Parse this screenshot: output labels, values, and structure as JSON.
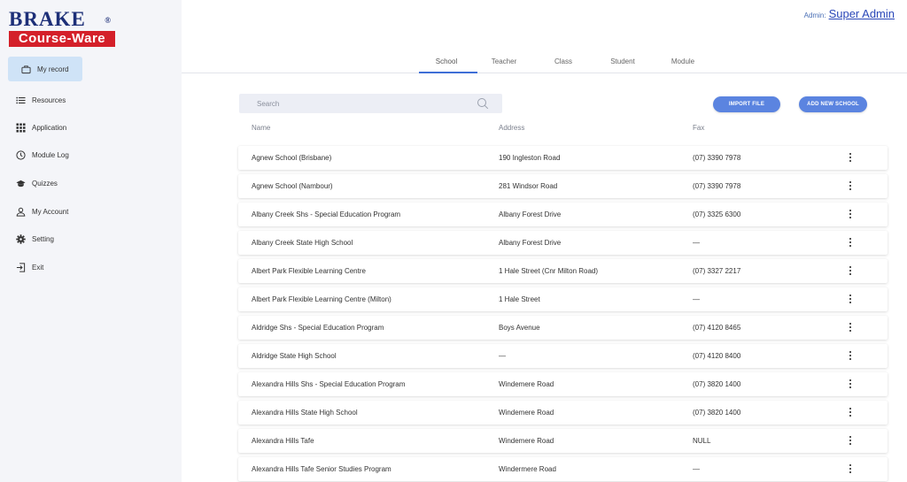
{
  "logo": {
    "brand_top": "BRAKE",
    "brand_bottom": "Course-Ware",
    "registered": "®"
  },
  "sidebar": {
    "active_item": {
      "label": "My record",
      "icon": "briefcase-icon"
    },
    "items": [
      {
        "label": "Resources",
        "icon": "list-icon"
      },
      {
        "label": "Application",
        "icon": "grid-icon"
      },
      {
        "label": "Module Log",
        "icon": "clock-icon"
      },
      {
        "label": "Quizzes",
        "icon": "graduation-cap-icon"
      },
      {
        "label": "My Account",
        "icon": "user-icon"
      },
      {
        "label": "Setting",
        "icon": "gear-icon"
      },
      {
        "label": "Exit",
        "icon": "exit-icon"
      }
    ]
  },
  "header": {
    "admin_label": "Admin:",
    "admin_name": "Super Admin"
  },
  "tabs": [
    {
      "label": "School",
      "active": true
    },
    {
      "label": "Teacher",
      "active": false
    },
    {
      "label": "Class",
      "active": false
    },
    {
      "label": "Student",
      "active": false
    },
    {
      "label": "Module",
      "active": false
    }
  ],
  "toolbar": {
    "search_placeholder": "Search",
    "search_value": "",
    "import_label": "IMPORT FILE",
    "add_label": "ADD NEW SCHOOL"
  },
  "table": {
    "columns": [
      "Name",
      "Address",
      "Fax"
    ],
    "rows": [
      {
        "name": "Agnew School (Brisbane)",
        "address": "190 Ingleston Road",
        "fax": "(07) 3390 7978"
      },
      {
        "name": "Agnew School (Nambour)",
        "address": "281 Windsor Road",
        "fax": "(07) 3390 7978"
      },
      {
        "name": "Albany Creek Shs - Special Education Program",
        "address": "Albany Forest Drive",
        "fax": "(07) 3325 6300"
      },
      {
        "name": "Albany Creek State High School",
        "address": "Albany Forest Drive",
        "fax": "—"
      },
      {
        "name": "Albert Park Flexible Learning Centre",
        "address": "1 Hale Street (Cnr Milton Road)",
        "fax": "(07) 3327 2217"
      },
      {
        "name": "Albert Park Flexible Learning Centre (Milton)",
        "address": "1 Hale Street",
        "fax": "—"
      },
      {
        "name": "Aldridge Shs - Special Education Program",
        "address": "Boys Avenue",
        "fax": "(07) 4120 8465"
      },
      {
        "name": "Aldridge State High School",
        "address": "—",
        "fax": "(07) 4120 8400"
      },
      {
        "name": "Alexandra Hills Shs - Special Education Program",
        "address": "Windemere Road",
        "fax": "(07) 3820 1400"
      },
      {
        "name": "Alexandra Hills State High School",
        "address": "Windemere Road",
        "fax": "(07) 3820 1400"
      },
      {
        "name": "Alexandra Hills Tafe",
        "address": "Windemere Road",
        "fax": "NULL"
      },
      {
        "name": "Alexandra Hills Tafe Senior Studies Program",
        "address": "Windermere Road",
        "fax": "—"
      }
    ]
  },
  "colors": {
    "accent": "#5b84e0",
    "brand_red": "#d4202a",
    "brand_blue": "#1d2f78",
    "sidebar_bg": "#f4f5f9",
    "active_bg": "#cfe3f7"
  }
}
